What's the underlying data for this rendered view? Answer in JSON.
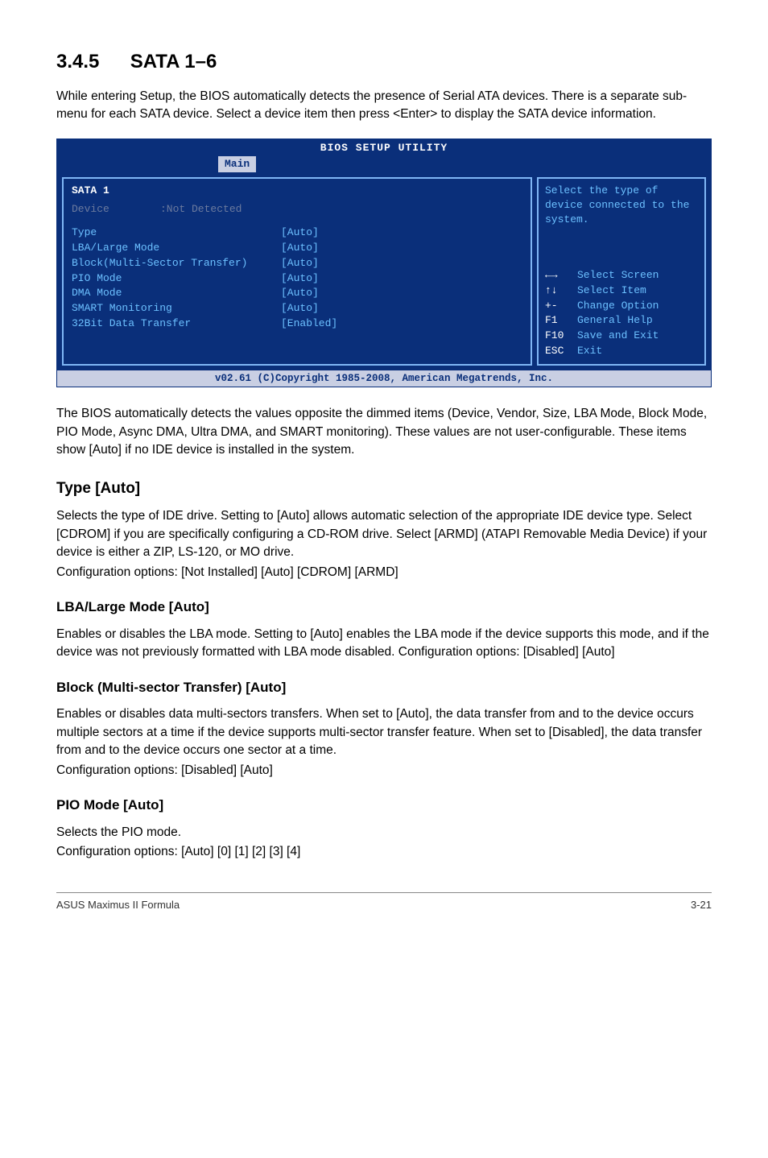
{
  "section": {
    "number": "3.4.5",
    "title": "SATA 1–6"
  },
  "intro": "While entering Setup, the BIOS automatically detects the presence of Serial ATA devices. There is a separate sub-menu for each SATA device. Select a device item then press <Enter> to display the SATA device information.",
  "bios": {
    "title": "BIOS SETUP UTILITY",
    "tab": "Main",
    "header": "SATA 1",
    "device_label": "Device",
    "device_value": ":Not Detected",
    "rows": [
      {
        "label": "Type",
        "value": "[Auto]"
      },
      {
        "label": "LBA/Large Mode",
        "value": "[Auto]"
      },
      {
        "label": "Block(Multi-Sector Transfer)",
        "value": "[Auto]"
      },
      {
        "label": "PIO Mode",
        "value": "[Auto]"
      },
      {
        "label": "DMA Mode",
        "value": "[Auto]"
      },
      {
        "label": "SMART Monitoring",
        "value": "[Auto]"
      },
      {
        "label": "32Bit Data Transfer",
        "value": "[Enabled]"
      }
    ],
    "help": "Select the type of device connected to the system.",
    "keys": [
      {
        "key": "←→",
        "label": "Select Screen"
      },
      {
        "key": "↑↓",
        "label": "Select Item"
      },
      {
        "key": "+-",
        "label": "Change Option"
      },
      {
        "key": "F1",
        "label": "General Help"
      },
      {
        "key": "F10",
        "label": "Save and Exit"
      },
      {
        "key": "ESC",
        "label": "Exit"
      }
    ],
    "footer": "v02.61 (C)Copyright 1985-2008, American Megatrends, Inc."
  },
  "after_bios": "The BIOS automatically detects the values opposite the dimmed items (Device, Vendor, Size, LBA Mode, Block Mode, PIO Mode, Async DMA, Ultra DMA, and SMART monitoring). These values are not user-configurable. These items show [Auto] if no IDE device is installed in the system.",
  "type": {
    "heading": "Type [Auto]",
    "p1": "Selects the type of IDE drive. Setting to [Auto] allows automatic selection of the appropriate IDE device type. Select [CDROM] if you are specifically configuring a CD-ROM drive. Select [ARMD] (ATAPI Removable Media Device) if your device is either a ZIP, LS-120, or MO drive.",
    "p2": "Configuration options: [Not Installed] [Auto] [CDROM] [ARMD]"
  },
  "lba": {
    "heading": "LBA/Large Mode [Auto]",
    "p": "Enables or disables the LBA mode. Setting to [Auto] enables the LBA mode if the device supports this mode, and if the device was not previously formatted with LBA mode disabled. Configuration options: [Disabled] [Auto]"
  },
  "block": {
    "heading": "Block (Multi-sector Transfer) [Auto]",
    "p1": "Enables or disables data multi-sectors transfers. When set to [Auto], the data transfer from and to the device occurs multiple sectors at a time if the device supports multi-sector transfer feature. When set to [Disabled], the data transfer from and to the device occurs one sector at a time.",
    "p2": "Configuration options: [Disabled] [Auto]"
  },
  "pio": {
    "heading": "PIO Mode [Auto]",
    "p1": "Selects the PIO mode.",
    "p2": "Configuration options: [Auto] [0] [1] [2] [3] [4]"
  },
  "footer": {
    "left": "ASUS Maximus II Formula",
    "right": "3-21"
  }
}
